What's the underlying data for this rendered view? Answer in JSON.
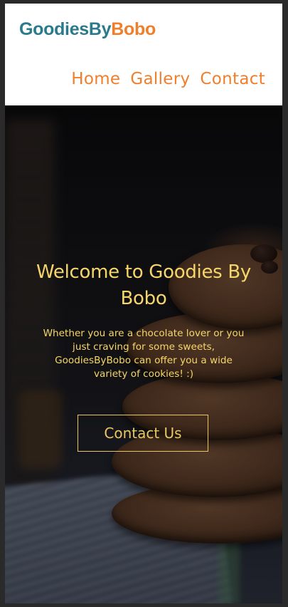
{
  "header": {
    "logo_part_a": "GoodiesBy",
    "logo_part_b": "Bobo",
    "nav": {
      "home": "Home",
      "gallery": "Gallery",
      "contact": "Contact"
    }
  },
  "hero": {
    "title": "Welcome to Goodies By Bobo",
    "text": "Whether you are a chocolate lover or you just craving for some sweets, GoodiesByBobo can offer you a wide variety of cookies! :)",
    "cta_label": "Contact Us"
  },
  "colors": {
    "brand_teal": "#2b7a8c",
    "brand_orange": "#f07f2c",
    "hero_text_yellow": "#f6d66a"
  }
}
